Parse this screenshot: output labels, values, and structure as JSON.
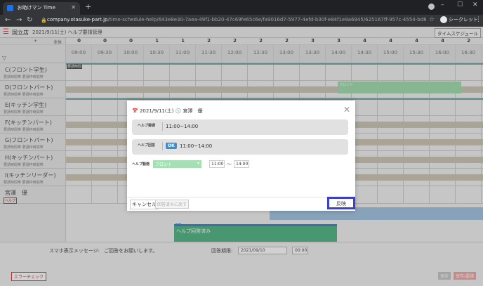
{
  "browser": {
    "tab_title": "お助けマン Time",
    "url_host": "company.otasuke-part.jp",
    "url_path": "/time-schedule-help/643e8e30-7aea-49f1-bb20-47c69fe65c6e/fa9016d7-5977-4efd-b30f-e84f1e9a6945/625167ff-957c-4554-bd81-90715534f109/1631286000...",
    "profile_label": "シークレット"
  },
  "header": {
    "store": "国立店",
    "title": "2021/9/11(土) ヘルプ要請管理",
    "timeline_button": "タイムスケジュール"
  },
  "timeline": {
    "plus": "+",
    "all": "全体",
    "hours": [
      "0",
      "0",
      "0",
      "1",
      "1",
      "2",
      "2",
      "2",
      "2",
      "3",
      "3",
      "4",
      "4",
      "4",
      "4",
      "2"
    ],
    "times": [
      "09:00",
      "09:30",
      "10:00",
      "10:30",
      "11:00",
      "11:30",
      "12:00",
      "12:30",
      "13:00",
      "13:30",
      "14:00",
      "14:30",
      "15:00",
      "15:30",
      "16:00",
      "16:30"
    ],
    "request_label": "要請時間",
    "green_label": "フロント",
    "answered_label": "ヘルプ回答済み",
    "ok_small": "OK",
    "rows": [
      {
        "name": "C(フロント学生)",
        "sub": "要請時間帯 要請枠時間帯"
      },
      {
        "name": "D(フロントパート)",
        "sub": "要請時間帯 要請枠時間帯"
      },
      {
        "name": "E(キッチン学生)",
        "sub": "要請時間帯 要請枠時間帯"
      },
      {
        "name": "F(キッチンパート)",
        "sub": "要請時間帯 要請枠時間帯"
      },
      {
        "name": "G(フロントパート)",
        "sub": "要請時間帯 要請枠時間帯"
      },
      {
        "name": "H(キッチンパート)",
        "sub": "要請時間帯 要請枠時間帯"
      },
      {
        "name": "I(キッチンリーダー)",
        "sub": "要請時間帯 要請枠時間帯"
      },
      {
        "name": "宮澤　優",
        "sub": "ヘルプ"
      }
    ]
  },
  "footer": {
    "sp_label": "スマホ表示メッセージ:",
    "sp_message": "ご回答をお願いします。",
    "due_label": "回答期限:",
    "due_date": "2021/09/10",
    "due_time": "00:00",
    "error_check": "エラーチェック",
    "save": "保存",
    "save_request": "保存/要請"
  },
  "modal": {
    "date": "2021/9/11(土)",
    "person": "宮澤　優",
    "request_label": "ヘルプ要請",
    "request_time": "11:00~14:00",
    "answer_label": "ヘルプ回答",
    "ok_badge": "OK",
    "answer_time": "11:00~14:00",
    "move_label": "ヘルプ動務",
    "department": "フロント",
    "time_from": "11:00",
    "tilde": "〜",
    "time_to": "14:00",
    "cancel": "キャンセル",
    "unanswered": "回答済みに戻す",
    "reflect": "反映"
  },
  "colors": {
    "accent_blue": "#3d8ecf",
    "highlight_border": "#3a3fcf",
    "department_green": "#a6dfb4",
    "answered_green": "#58b98a",
    "error_red": "#e53935"
  }
}
